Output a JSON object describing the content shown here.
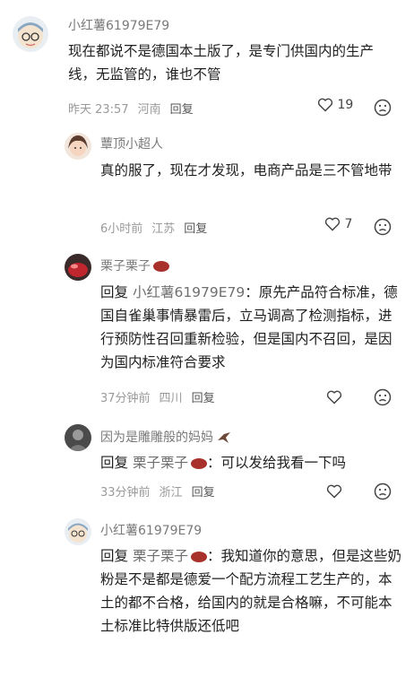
{
  "comments": [
    {
      "user": "小红薯61979E79",
      "text": "现在都说不是德国本土版了，是专门供国内的生产线，无监管的，谁也不管",
      "time": "昨天 23:57",
      "location": "河南",
      "reply_label": "回复",
      "likes": "19"
    },
    {
      "user": "蕈顶小超人",
      "text": "真的服了，现在才发现，电商产品是三不管地带",
      "time": "6小时前",
      "location": "江苏",
      "reply_label": "回复",
      "likes": "7"
    },
    {
      "user": "栗子栗子",
      "reply_prefix": "回复",
      "mention": "小红薯61979E79",
      "text": "：原先产品符合标准，德国自雀巢事情暴雷后，立马调高了检测指标，进行预防性召回重新检验，但是国内不召回，是因为国内标准符合要求",
      "time": "37分钟前",
      "location": "四川",
      "reply_label": "回复"
    },
    {
      "user": "因为是雕雕般的妈妈",
      "reply_prefix": "回复",
      "mention": "栗子栗子",
      "text": "：可以发给我看一下吗",
      "time": "33分钟前",
      "location": "浙江",
      "reply_label": "回复"
    },
    {
      "user": "小红薯61979E79",
      "reply_prefix": "回复",
      "mention": "栗子栗子",
      "text": "：我知道你的意思，但是这些奶粉是不是都是德爱一个配方流程工艺生产的，本土的都不合格，给国内的就是合格嘛，不可能本土标准比特供版还低吧"
    }
  ],
  "colors": {
    "name": "#7a7a7a",
    "meta": "#9a9a9a",
    "text": "#1f1f1f",
    "badge": "#a8322b"
  }
}
